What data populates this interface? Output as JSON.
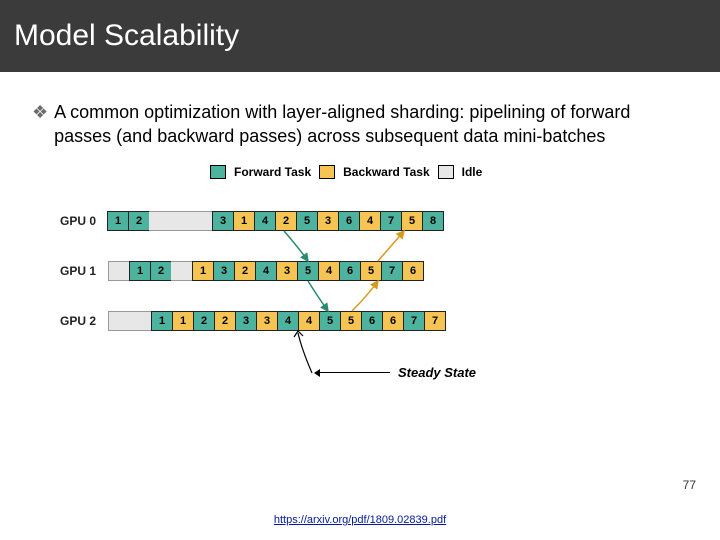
{
  "header": {
    "title": "Model Scalability"
  },
  "bullet": {
    "text": "A common optimization with layer-aligned sharding: pipelining of forward passes (and backward passes) across subsequent data mini-batches"
  },
  "legend": {
    "forward": "Forward Task",
    "backward": "Backward Task",
    "idle": "Idle"
  },
  "gpus": {
    "row0": {
      "label": "GPU 0"
    },
    "row1": {
      "label": "GPU 1"
    },
    "row2": {
      "label": "GPU 2"
    }
  },
  "steady_label": "Steady State",
  "page_number": "77",
  "reference_link": "https://arxiv.org/pdf/1809.02839.pdf",
  "chart_data": {
    "type": "gantt",
    "title": "Pipeline parallel schedule across 3 GPUs",
    "legend": [
      "Forward Task",
      "Backward Task",
      "Idle"
    ],
    "rows": [
      {
        "gpu": "GPU 0",
        "leading_idle_slots": 0,
        "tasks": [
          {
            "t": "f",
            "n": 1
          },
          {
            "t": "f",
            "n": 2
          },
          {
            "t": "gap"
          },
          {
            "t": "gap"
          },
          {
            "t": "gap"
          },
          {
            "t": "f",
            "n": 3
          },
          {
            "t": "b",
            "n": 1
          },
          {
            "t": "f",
            "n": 4
          },
          {
            "t": "b",
            "n": 2
          },
          {
            "t": "f",
            "n": 5
          },
          {
            "t": "b",
            "n": 3
          },
          {
            "t": "f",
            "n": 6
          },
          {
            "t": "b",
            "n": 4
          },
          {
            "t": "f",
            "n": 7
          },
          {
            "t": "b",
            "n": 5
          },
          {
            "t": "f",
            "n": 8
          }
        ]
      },
      {
        "gpu": "GPU 1",
        "leading_idle_slots": 1,
        "tasks": [
          {
            "t": "f",
            "n": 1
          },
          {
            "t": "f",
            "n": 2
          },
          {
            "t": "gap"
          },
          {
            "t": "b",
            "n": 1
          },
          {
            "t": "f",
            "n": 3
          },
          {
            "t": "b",
            "n": 2
          },
          {
            "t": "f",
            "n": 4
          },
          {
            "t": "b",
            "n": 3
          },
          {
            "t": "f",
            "n": 5
          },
          {
            "t": "b",
            "n": 4
          },
          {
            "t": "f",
            "n": 6
          },
          {
            "t": "b",
            "n": 5
          },
          {
            "t": "f",
            "n": 7
          },
          {
            "t": "b",
            "n": 6
          }
        ]
      },
      {
        "gpu": "GPU 2",
        "leading_idle_slots": 2,
        "tasks": [
          {
            "t": "f",
            "n": 1
          },
          {
            "t": "b",
            "n": 1
          },
          {
            "t": "f",
            "n": 2
          },
          {
            "t": "b",
            "n": 2
          },
          {
            "t": "f",
            "n": 3
          },
          {
            "t": "b",
            "n": 3
          },
          {
            "t": "f",
            "n": 4
          },
          {
            "t": "b",
            "n": 4
          },
          {
            "t": "f",
            "n": 5
          },
          {
            "t": "b",
            "n": 5
          },
          {
            "t": "f",
            "n": 6
          },
          {
            "t": "b",
            "n": 6
          },
          {
            "t": "f",
            "n": 7
          },
          {
            "t": "b",
            "n": 7
          }
        ]
      }
    ],
    "arrows_note": "forward arrows (green) flow GPU0→GPU1→GPU2; backward arrows (orange) flow GPU2→GPU1→GPU0",
    "steady_state_marker_after_slot": 8
  }
}
